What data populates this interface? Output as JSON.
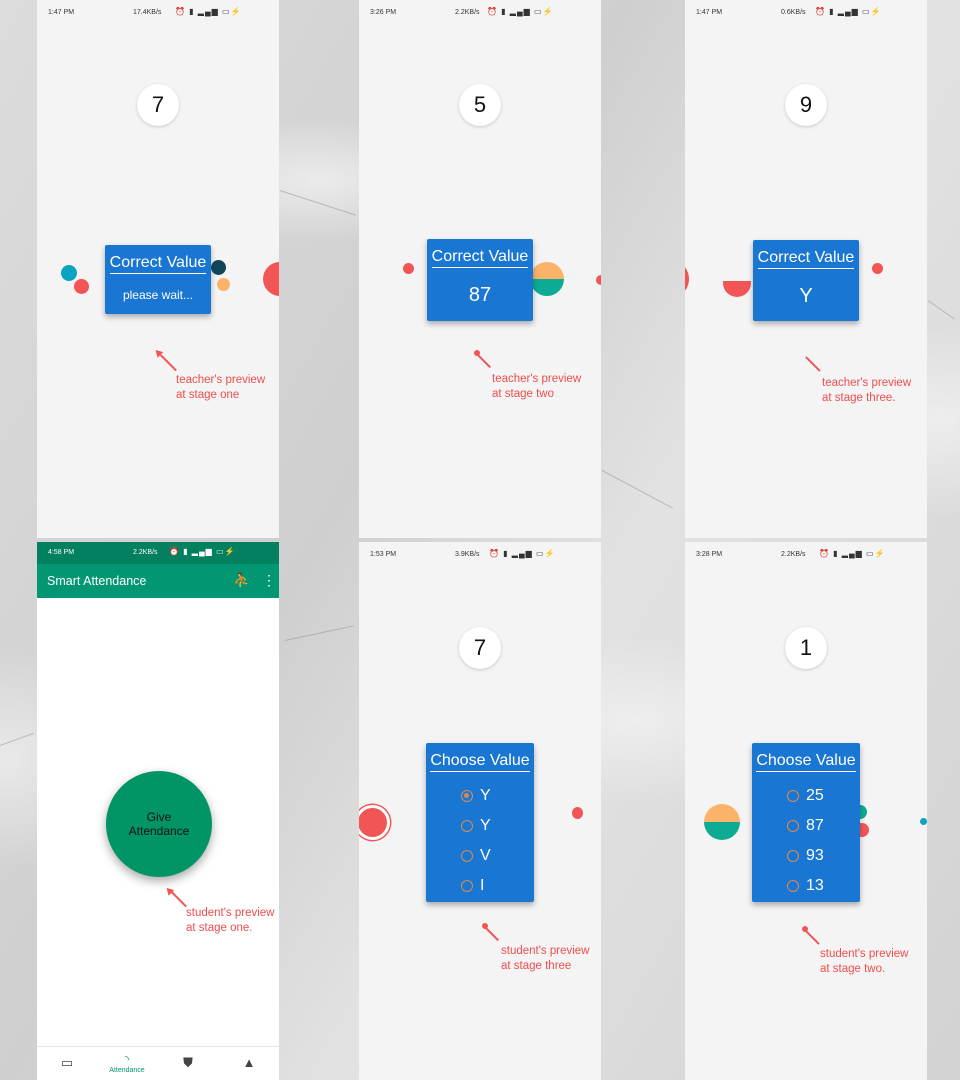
{
  "colors": {
    "card_blue": "#1976d2",
    "accent_green": "#029672",
    "annotation_red": "#ef4d4d",
    "radio_orange": "#e0894e"
  },
  "screens": {
    "teacher_stage1": {
      "status": {
        "time": "1:47 PM",
        "net": "17.4KB/s"
      },
      "timer": "7",
      "card_title": "Correct Value",
      "card_text": "please wait...",
      "note_line1": "teacher's preview",
      "note_line2": "at stage one"
    },
    "teacher_stage2": {
      "status": {
        "time": "3:26 PM",
        "net": "2.2KB/s"
      },
      "timer": "5",
      "card_title": "Correct Value",
      "card_value": "87",
      "note_line1": "teacher's preview",
      "note_line2": "at stage two"
    },
    "teacher_stage3": {
      "status": {
        "time": "1:47 PM",
        "net": "0.6KB/s"
      },
      "timer": "9",
      "card_title": "Correct Value",
      "card_value": "Y",
      "note_line1": "teacher's preview",
      "note_line2": "at stage three."
    },
    "student_stage1": {
      "status": {
        "time": "4:58 PM",
        "net": "2.2KB/s"
      },
      "app_title": "Smart Attendance",
      "button_line1": "Give",
      "button_line2": "Attendance",
      "nav": {
        "active_label": "Attendance",
        "icons": [
          "calendar-icon",
          "rss-icon",
          "shield-check-icon",
          "warning-icon"
        ]
      },
      "note_line1": "student's preview",
      "note_line2": "at stage one."
    },
    "student_stage3": {
      "status": {
        "time": "1:53 PM",
        "net": "3.9KB/s"
      },
      "timer": "7",
      "card_title": "Choose Value",
      "options": [
        "Y",
        "Y",
        "V",
        "I"
      ],
      "selected_index": 0,
      "note_line1": "student's preview",
      "note_line2": "at stage three"
    },
    "student_stage2": {
      "status": {
        "time": "3:28 PM",
        "net": "2.2KB/s"
      },
      "timer": "1",
      "card_title": "Choose Value",
      "options": [
        "25",
        "87",
        "93",
        "13"
      ],
      "note_line1": "student's preview",
      "note_line2": "at stage two."
    }
  }
}
